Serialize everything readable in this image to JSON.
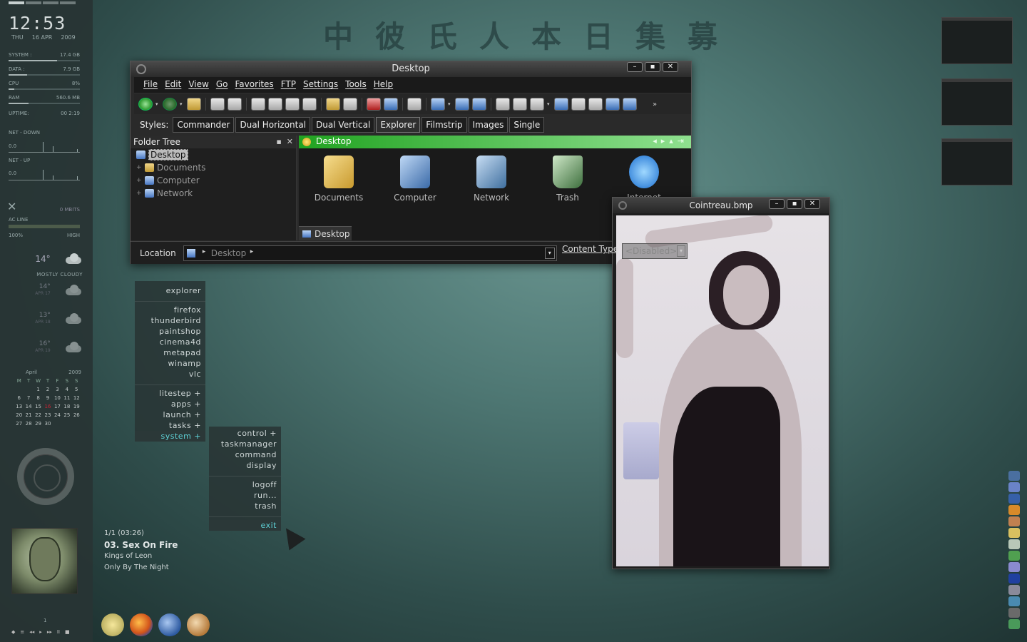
{
  "sidebar": {
    "clock": "12:53",
    "day": "THU",
    "date": "16 APR",
    "year": "2009",
    "stats": [
      {
        "label": "SYSTEM :",
        "value": "17.4 GB",
        "fill": 0.68
      },
      {
        "label": "DATA :",
        "value": "7.9 GB",
        "fill": 0.26
      },
      {
        "label": "CPU",
        "value": "8%",
        "fill": 0.08
      },
      {
        "label": "RAM",
        "value": "560.6 MB",
        "fill": 0.28
      }
    ],
    "uptime_label": "UPTIME:",
    "uptime_value": "00 2:19",
    "net_down_label": "NET - DOWN",
    "net_down_value": "0.0",
    "net_up_label": "NET - UP",
    "net_up_value": "0.0",
    "mbits": "0 MBITS",
    "ac_line": "AC LINE",
    "ac_low": "100%",
    "ac_high": "HIGH",
    "weather_desc": "MOSTLY CLOUDY",
    "weather": [
      {
        "temp": "14°",
        "date": ""
      },
      {
        "temp": "14°",
        "date": "APR 17"
      },
      {
        "temp": "13°",
        "date": "APR 18"
      },
      {
        "temp": "16°",
        "date": "APR 19"
      }
    ],
    "calendar": {
      "month": "April",
      "year": "2009",
      "day_names": [
        "M",
        "T",
        "W",
        "T",
        "F",
        "S",
        "S"
      ],
      "days": [
        "",
        "",
        "1",
        "2",
        "3",
        "4",
        "5",
        "6",
        "7",
        "8",
        "9",
        "10",
        "11",
        "12",
        "13",
        "14",
        "15",
        "16",
        "17",
        "18",
        "19",
        "20",
        "21",
        "22",
        "23",
        "24",
        "25",
        "26",
        "27",
        "28",
        "29",
        "30",
        "",
        "",
        "",
        "",
        ""
      ],
      "today": "16"
    },
    "player_num": "1",
    "player_controls": [
      "◆",
      "≡",
      "◂◂",
      "▸",
      "▸▸",
      "II",
      "■"
    ]
  },
  "header_chars": "中彼氏人本日集募",
  "explorer": {
    "title": "Desktop",
    "menu": [
      "File",
      "Edit",
      "View",
      "Go",
      "Favorites",
      "FTP",
      "Settings",
      "Tools",
      "Help"
    ],
    "styles_label": "Styles:",
    "styles": [
      "Commander",
      "Dual Horizontal",
      "Dual Vertical",
      "Explorer",
      "Filmstrip",
      "Images",
      "Single"
    ],
    "active_style": "Explorer",
    "folder_tree_title": "Folder Tree",
    "tree": [
      {
        "label": "Desktop"
      },
      {
        "label": "Documents"
      },
      {
        "label": "Computer"
      },
      {
        "label": "Network"
      }
    ],
    "path": "Desktop",
    "files": [
      {
        "label": "Documents"
      },
      {
        "label": "Computer"
      },
      {
        "label": "Network"
      },
      {
        "label": "Trash"
      },
      {
        "label": "Internet"
      }
    ],
    "bottom_tab": "Desktop",
    "location_label": "Location",
    "location_value": "Desktop",
    "content_type_label": "Content Type",
    "content_type_value": "<Disabled>"
  },
  "viewer": {
    "title": "Cointreau.bmp"
  },
  "menu1": {
    "items": [
      "explorer",
      "firefox",
      "thunderbird",
      "paintshop",
      "cinema4d",
      "metapad",
      "winamp",
      "vlc",
      "litestep +",
      "apps +",
      "launch +",
      "tasks +",
      "system +"
    ]
  },
  "menu2": {
    "items": [
      "control +",
      "taskmanager",
      "command",
      "display",
      "logoff",
      "run...",
      "trash",
      "exit"
    ]
  },
  "nowplaying": {
    "track_num": "1/1 (03:26)",
    "title": "03. Sex On Fire",
    "artist": "Kings of Leon",
    "album": "Only By The Night"
  },
  "colors": {
    "accent": "#5fd3d8",
    "path_green": "#21a321"
  }
}
